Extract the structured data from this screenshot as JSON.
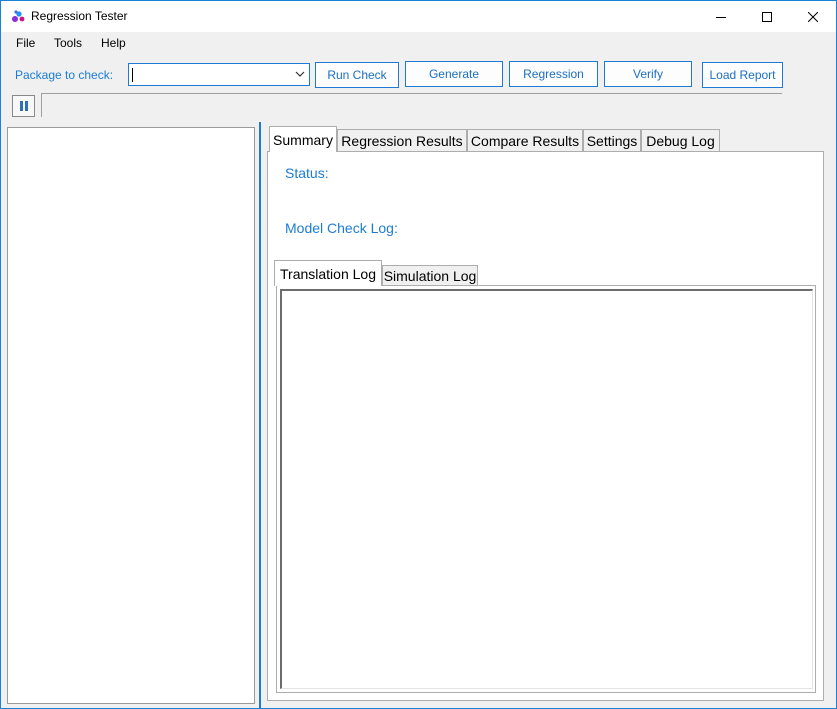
{
  "window": {
    "title": "Regression Tester",
    "accent_color": "#1e7ad3",
    "label_color": "#1c7cd5"
  },
  "titlebar_buttons": {
    "minimize_icon": "minimize-icon",
    "maximize_icon": "maximize-icon",
    "close_icon": "close-icon"
  },
  "menu": {
    "items": [
      {
        "label": "File"
      },
      {
        "label": "Tools"
      },
      {
        "label": "Help"
      }
    ]
  },
  "toolbar": {
    "package_label": "Package to check:",
    "package_value": "",
    "run_check": "Run Check",
    "generate": "Generate",
    "regression": "Regression",
    "verify": "Verify",
    "load_report": "Load Report"
  },
  "tabs": [
    {
      "label": "Summary",
      "active": true
    },
    {
      "label": "Regression Results",
      "active": false
    },
    {
      "label": "Compare Results",
      "active": false
    },
    {
      "label": "Settings",
      "active": false
    },
    {
      "label": "Debug Log",
      "active": false
    }
  ],
  "summary": {
    "status_label": "Status:",
    "model_check_log_label": "Model Check Log:"
  },
  "log_tabs": [
    {
      "label": "Translation Log",
      "active": true
    },
    {
      "label": "Simulation Log",
      "active": false
    }
  ],
  "translation_log": ""
}
